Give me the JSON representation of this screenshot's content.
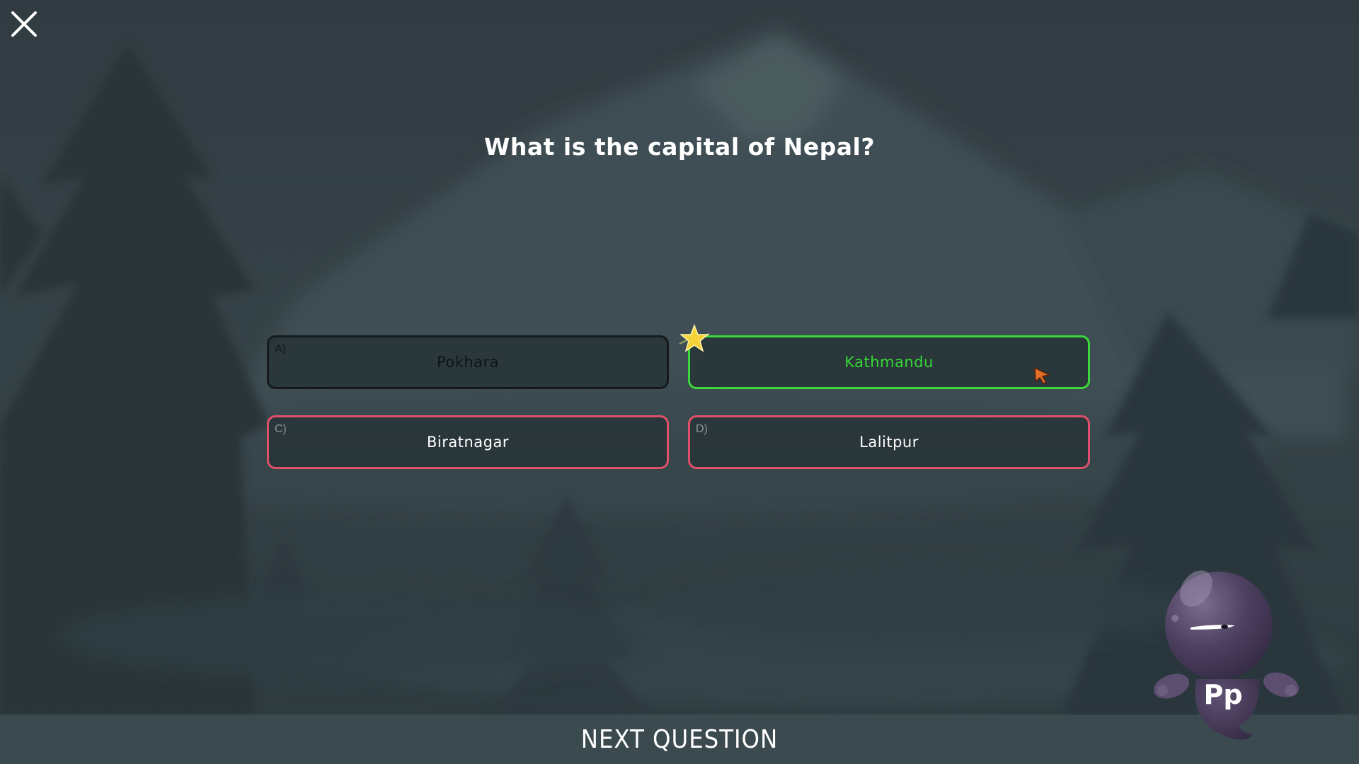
{
  "question": "What is the capital of Nepal?",
  "answers": [
    {
      "letter": "A)",
      "text": "Pokhara",
      "state": "neutral"
    },
    {
      "letter": "",
      "text": "Kathmandu",
      "state": "correct"
    },
    {
      "letter": "C)",
      "text": "Biratnagar",
      "state": "wrong"
    },
    {
      "letter": "D)",
      "text": "Lalitpur",
      "state": "wrong"
    }
  ],
  "next_button": {
    "label": "NEXT QUESTION"
  },
  "mascot": {
    "badge": "Pp"
  },
  "colors": {
    "correct": "#3ad83a",
    "wrong": "#e0506a",
    "neutral_border": "#141a1c",
    "background": "#37464a"
  },
  "icons": {
    "close": "close-icon",
    "star": "star-icon",
    "cursor": "cursor-icon"
  }
}
